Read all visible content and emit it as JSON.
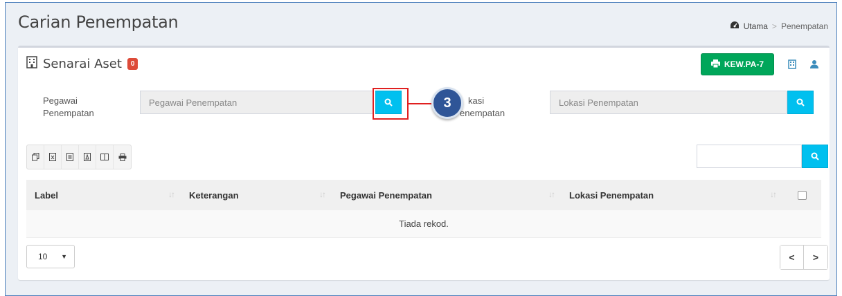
{
  "page": {
    "title": "Carian Penempatan"
  },
  "breadcrumb": {
    "home": "Utama",
    "separator": ">",
    "current": "Penempatan"
  },
  "panel": {
    "title": "Senarai Aset",
    "count_badge": "0",
    "print_button": "KEW.PA-7"
  },
  "filters": {
    "pegawai": {
      "label_line1": "Pegawai",
      "label_line2": "Penempatan",
      "placeholder": "Pegawai Penempatan"
    },
    "lokasi": {
      "label_line1": "kasi",
      "label_line2": "enempatan",
      "placeholder": "Lokasi Penempatan"
    }
  },
  "annotation": {
    "step_number": "3"
  },
  "toolbar": {
    "tools": [
      "copy-icon",
      "excel-icon",
      "csv-icon",
      "pdf-icon",
      "columns-icon",
      "print-icon"
    ]
  },
  "table": {
    "headers": [
      "Label",
      "Keterangan",
      "Pegawai Penempatan",
      "Lokasi Penempatan"
    ],
    "empty_text": "Tiada rekod."
  },
  "pagination": {
    "page_size": "10",
    "prev": "<",
    "next": ">"
  },
  "colors": {
    "accent": "#00c0ef",
    "success": "#00a65a",
    "danger": "#dd4b39",
    "step": "#2f5597",
    "highlight": "#e02020"
  }
}
